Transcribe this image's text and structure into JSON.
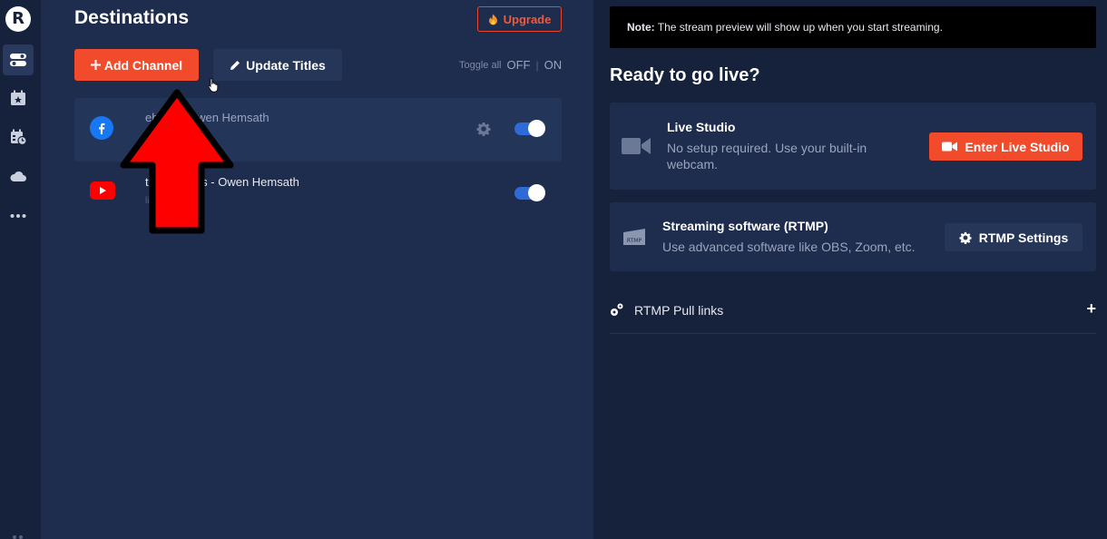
{
  "sidebar": {
    "logo": "R",
    "items": [
      {
        "icon": "toggles-icon",
        "active": true
      },
      {
        "icon": "calendar-star-icon",
        "active": false
      },
      {
        "icon": "calendar-schedule-icon",
        "active": false
      },
      {
        "icon": "cloud-icon",
        "active": false
      },
      {
        "icon": "more-dots-icon",
        "active": false
      }
    ]
  },
  "destinations": {
    "title": "Destinations",
    "upgrade_label": "Upgrade",
    "add_channel_label": "Add Channel",
    "update_titles_label": "Update Titles",
    "toggle_all_label": "Toggle all",
    "toggle_off_label": "OFF",
    "toggle_on_label": "ON",
    "channels": [
      {
        "name": "Facebook - Owen Hemsath",
        "visible_name": "ebook - Owen Hemsath",
        "status": "e",
        "platform": "facebook",
        "enabled": true
      },
      {
        "name": "Youtube Events - Owen Hemsath",
        "visible_name": "tube Events - Owen Hemsath",
        "status": "line",
        "platform": "youtube",
        "enabled": true
      }
    ]
  },
  "preview": {
    "note_bold": "Note:",
    "note_text": " The stream preview will show up when you start streaming."
  },
  "go_live": {
    "title": "Ready to go live?",
    "live_studio": {
      "title": "Live Studio",
      "description": "No setup required. Use your built-in webcam.",
      "button_label": "Enter Live Studio"
    },
    "rtmp": {
      "title": "Streaming software (RTMP)",
      "description": "Use advanced software like OBS, Zoom, etc.",
      "button_label": "RTMP Settings",
      "icon_text": "RTMP"
    },
    "pull_links_label": "RTMP Pull links",
    "plus": "+"
  },
  "colors": {
    "accent": "#f14b2c",
    "toggle_on": "#2f6ad9",
    "background": "#1e2c4d"
  }
}
